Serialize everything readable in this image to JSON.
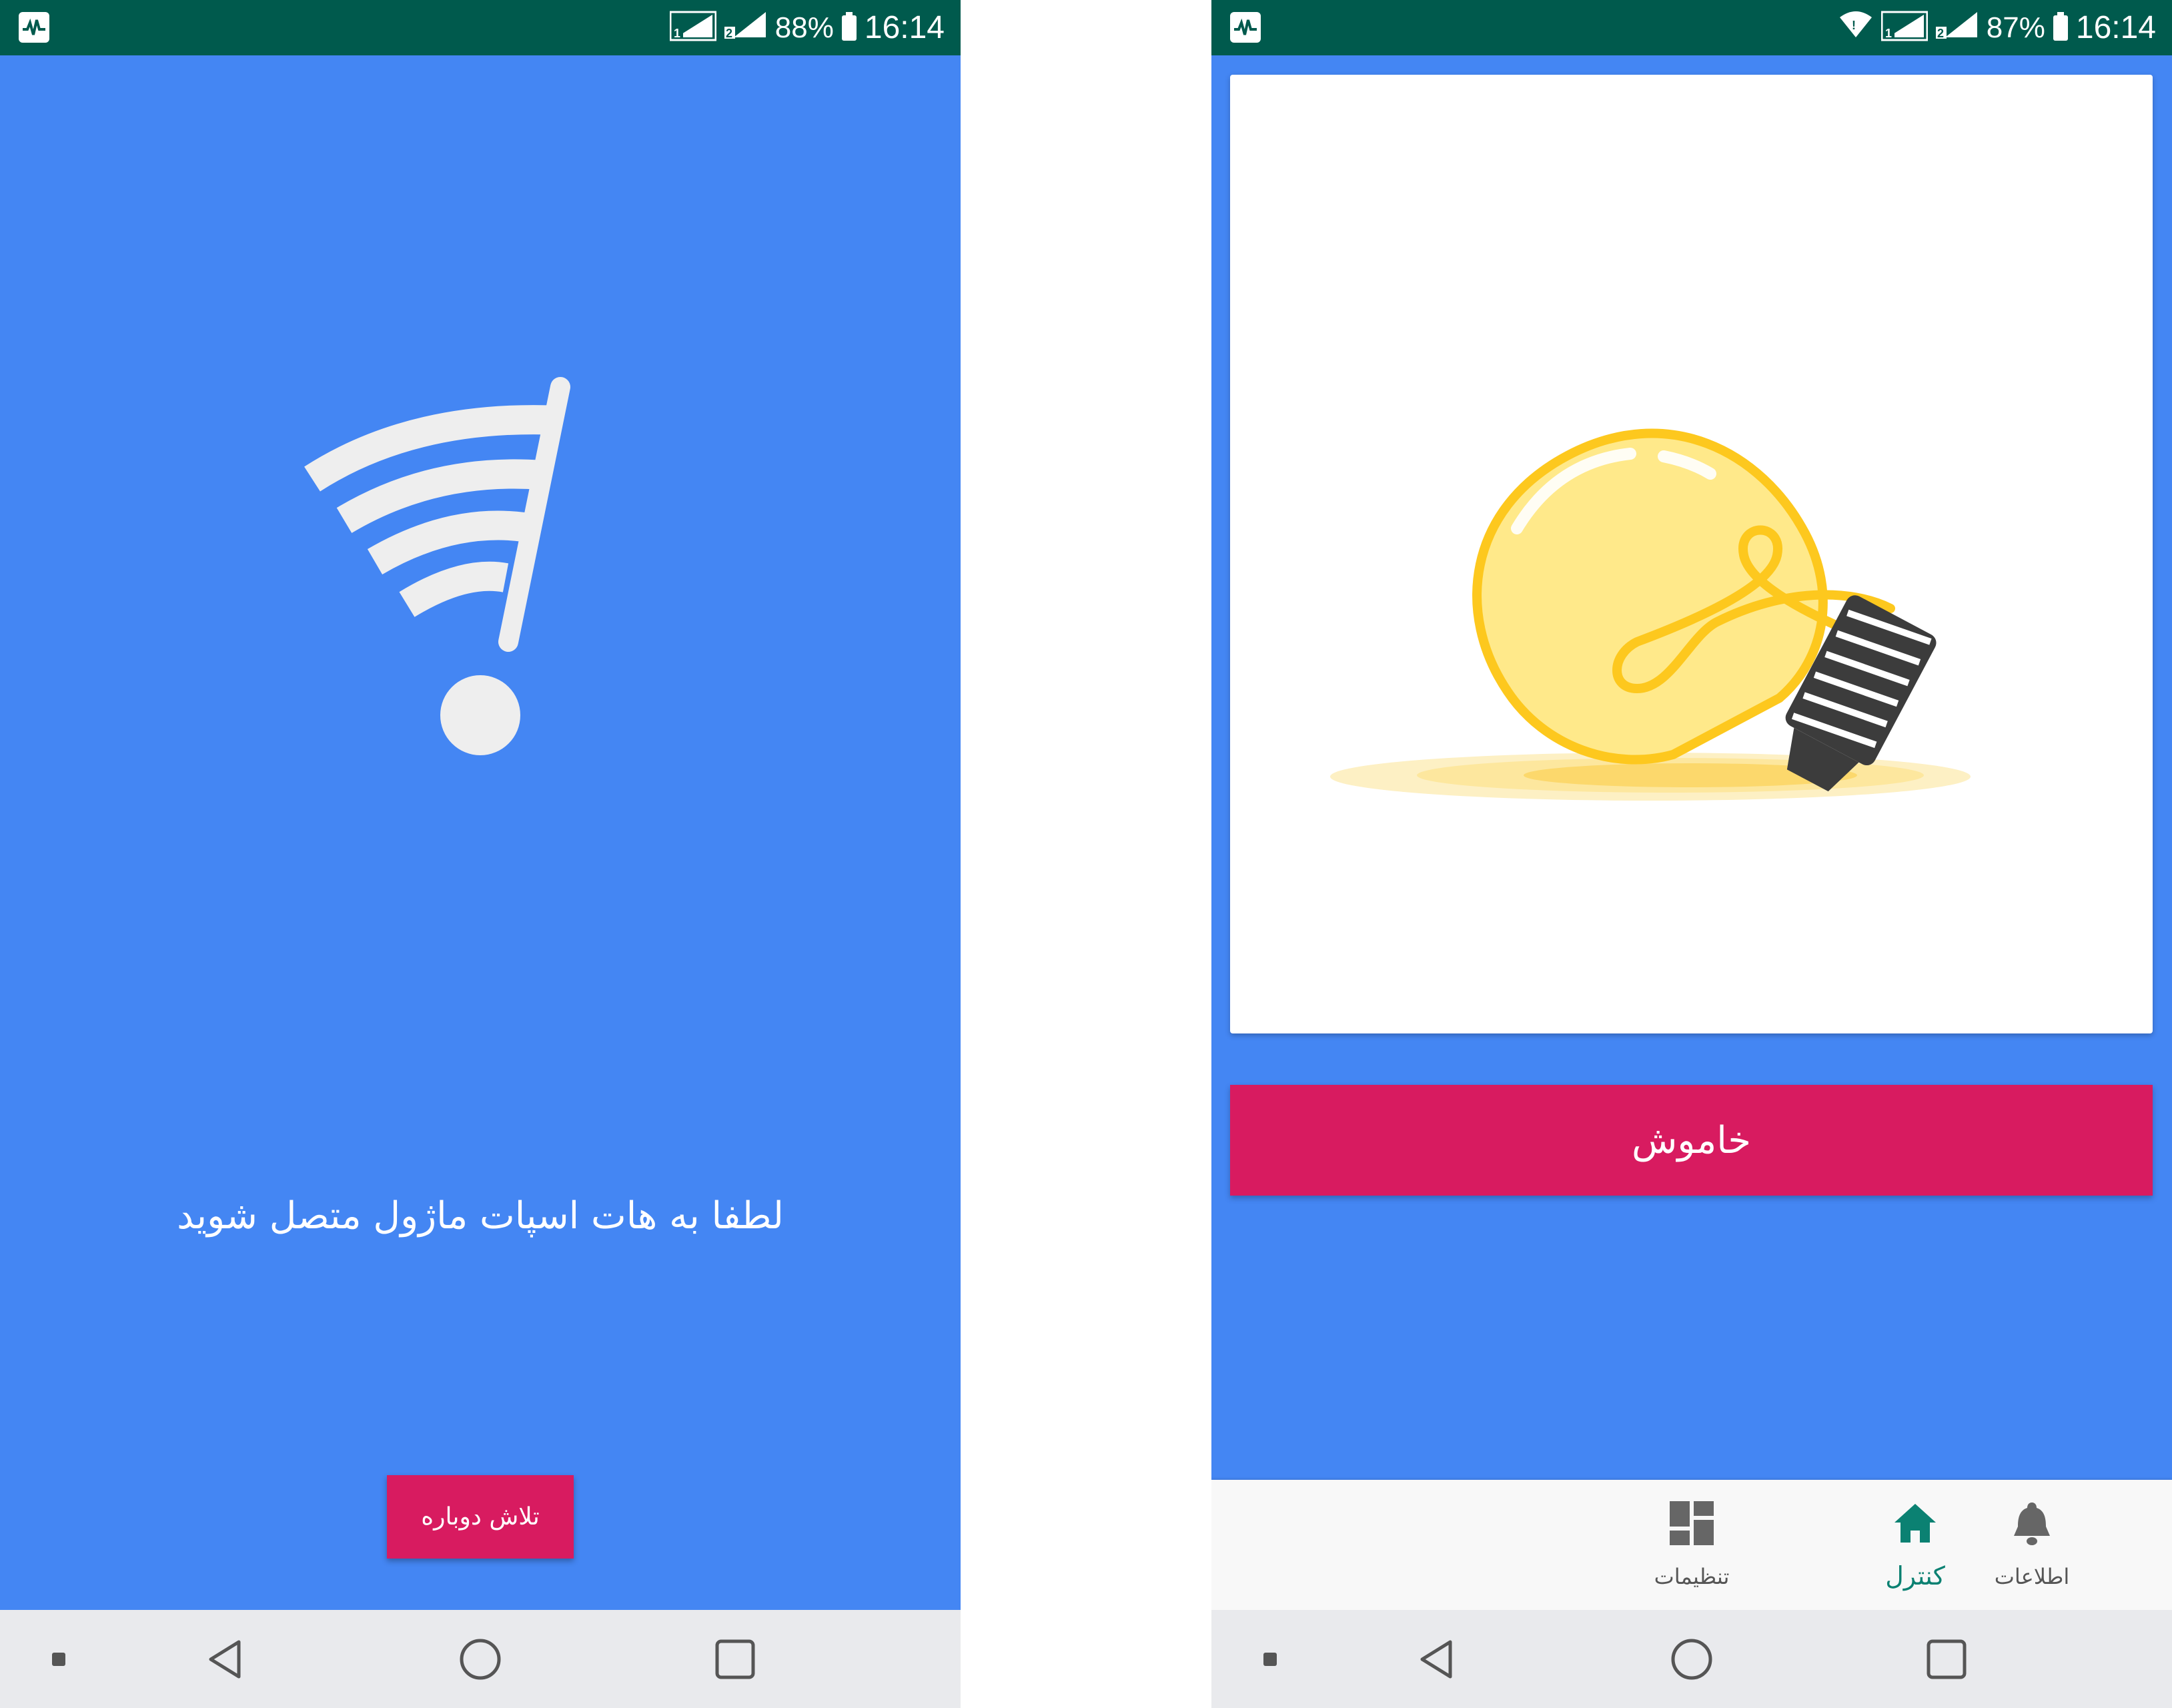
{
  "colors": {
    "background_blue": "#4486f3",
    "status_bar": "#005a4d",
    "accent_pink": "#d81b60",
    "active_teal": "#0b8172",
    "icon_white": "#eeeeee"
  },
  "left_screen": {
    "status_bar": {
      "battery": "88%",
      "time": "16:14",
      "sim_badges": [
        "1",
        "2"
      ]
    },
    "icons": [
      "wifi-alert-icon"
    ],
    "message": "لطفا به هات اسپات ماژول متصل شوید",
    "retry_button": "تلاش دوباره",
    "nav_bar": [
      "recent-dot-icon",
      "back-icon",
      "home-icon",
      "overview-icon"
    ]
  },
  "right_screen": {
    "status_bar": {
      "battery": "87%",
      "time": "16:14",
      "sim_badges": [
        "1",
        "2"
      ],
      "wifi_connected": true
    },
    "icons": [
      "light-bulb-icon"
    ],
    "power_button": "خاموش",
    "bottom_nav": {
      "items": [
        {
          "label": "کنترل",
          "icon": "home-icon",
          "active": true
        },
        {
          "label": "تنظیمات",
          "icon": "dashboard-icon",
          "active": false
        },
        {
          "label": "اطلاعات",
          "icon": "bell-icon",
          "active": false
        }
      ]
    },
    "nav_bar": [
      "recent-dot-icon",
      "back-icon",
      "home-icon",
      "overview-icon"
    ]
  }
}
